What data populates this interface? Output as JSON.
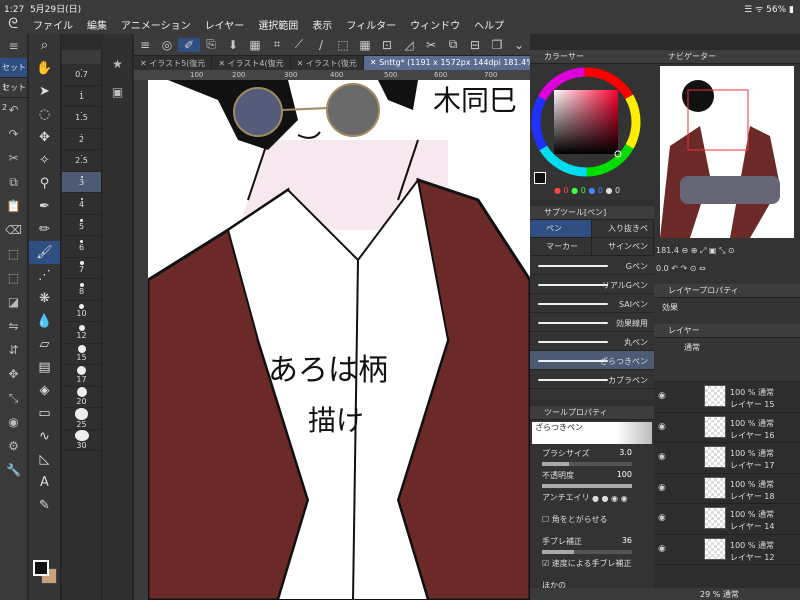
{
  "status": {
    "time": "1:27",
    "date": "5月29日(日)",
    "battery": "56%"
  },
  "menu": [
    "ファイル",
    "編集",
    "アニメーション",
    "レイヤー",
    "選択範囲",
    "表示",
    "フィルター",
    "ウィンドウ",
    "ヘルプ"
  ],
  "tool_sets": [
    "セット1",
    "セット2"
  ],
  "brush_sizes": [
    "0.7",
    "1",
    "1.5",
    "2",
    "2.5",
    "3",
    "4",
    "5",
    "6",
    "7",
    "8",
    "10",
    "12",
    "15",
    "17",
    "20",
    "25",
    "30"
  ],
  "active_brush_size": "3",
  "tabs": [
    "イラスト5(復元",
    "イラスト4(復元",
    "イラスト(復元",
    "Snttg* (1191 x 1572px 144dpi 181.4%)"
  ],
  "ruler": [
    "100",
    "200",
    "300",
    "400",
    "500",
    "600",
    "700"
  ],
  "canvas_text": {
    "label1": "あろは柄",
    "label2": "描け",
    "corner": "木同巳"
  },
  "color_panel": {
    "title": "カラーサー",
    "r": "0",
    "g": "0",
    "b": "0",
    "a": "0"
  },
  "subtool": {
    "title": "サブツール[ペン]",
    "tabs": [
      "ペン",
      "入り抜きペ",
      "マーカー",
      "サインペン"
    ],
    "brushes": [
      "Gペン",
      "リアルGペン",
      "SAIペン",
      "効果線用",
      "丸ペン",
      "ざらつきペン",
      "カブラペン"
    ],
    "active": "ざらつきペン"
  },
  "toolprop": {
    "title": "ツールプロパティ",
    "preset": "ざらつきペン",
    "brush_size_label": "ブラシサイズ",
    "brush_size_value": "3.0",
    "opacity_label": "不透明度",
    "opacity_value": "100",
    "antialias_label": "アンチエイリ",
    "corner_label": "角をとがらせる",
    "stabilize_label": "手ブレ補正",
    "stabilize_value": "36",
    "speed_label": "速度による手ブレ補正",
    "more": "ほかの"
  },
  "navigator": {
    "title": "ナビゲーター",
    "zoom": "181.4",
    "rotate": "0.0"
  },
  "layer_property": {
    "title": "レイヤープロパティ",
    "effect": "効果"
  },
  "layers_panel": {
    "title": "レイヤー",
    "blend": "通常",
    "layers": [
      {
        "mode": "100 % 通常",
        "name": "レイヤー 15"
      },
      {
        "mode": "100 % 通常",
        "name": "レイヤー 16"
      },
      {
        "mode": "100 % 通常",
        "name": "レイヤー 17"
      },
      {
        "mode": "100 % 通常",
        "name": "レイヤー 18"
      },
      {
        "mode": "100 % 通常",
        "name": "レイヤー 14"
      },
      {
        "mode": "100 % 通常",
        "name": "レイヤー 12"
      }
    ],
    "bottom": "29 % 通常"
  },
  "colors": {
    "jacket": "#6b2a28",
    "accent": "#2f4f82",
    "panel": "#2e2e2e",
    "skin": "#f7e8ef"
  }
}
